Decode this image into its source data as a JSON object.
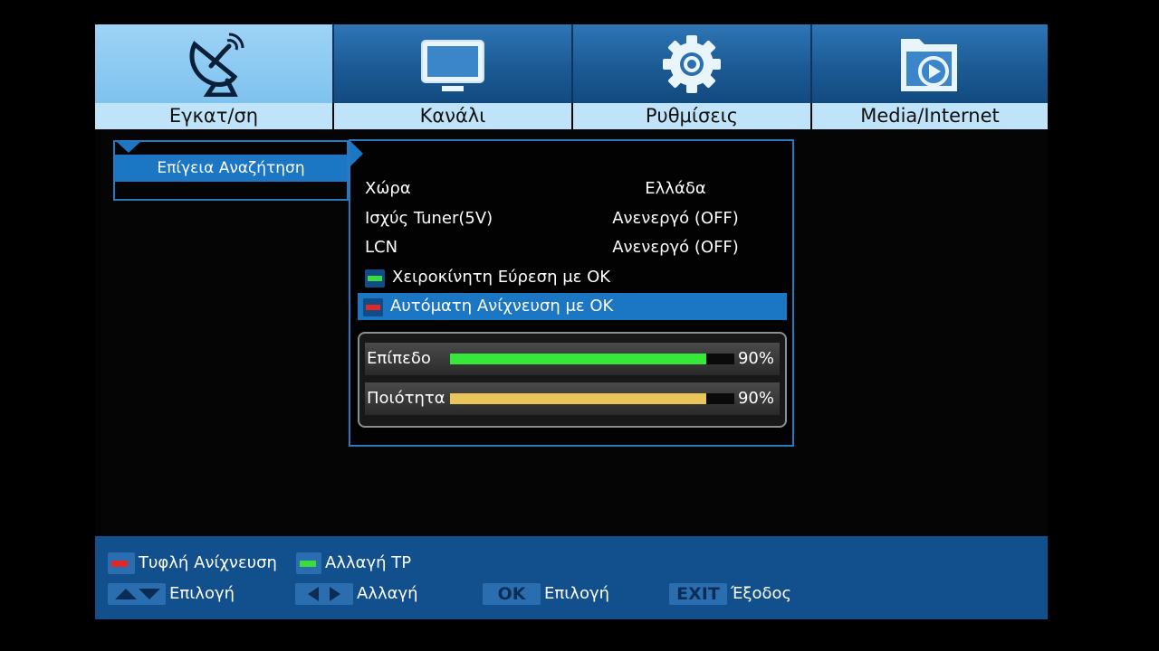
{
  "tabs": [
    {
      "label": "Εγκατ/ση",
      "icon": "satellite-dish-icon",
      "active": true
    },
    {
      "label": "Κανάλι",
      "icon": "tv-icon",
      "active": false
    },
    {
      "label": "Ρυθμίσεις",
      "icon": "gear-icon",
      "active": false
    },
    {
      "label": "Media/Internet",
      "icon": "media-folder-icon",
      "active": false
    }
  ],
  "left_menu": {
    "selected_item": "Επίγεια Αναζήτηση"
  },
  "settings": {
    "country": {
      "label": "Χώρα",
      "value": "Ελλάδα"
    },
    "tuner_power": {
      "label": "Ισχύς Tuner(5V)",
      "value": "Ανενεργό (OFF)"
    },
    "lcn": {
      "label": "LCN",
      "value": "Ανενεργό (OFF)"
    },
    "manual_search": {
      "label": "Χειροκίνητη Εύρεση με ΟΚ",
      "key_color": "#3ddc3d"
    },
    "auto_scan": {
      "label": "Αυτόματη Ανίχνευση με ΟΚ",
      "key_color": "#e02828"
    }
  },
  "signal": {
    "level": {
      "label": "Επίπεδο",
      "value_text": "90%",
      "fraction": 0.9,
      "color": "#35e83a"
    },
    "quality": {
      "label": "Ποιότητα",
      "value_text": "90%",
      "fraction": 0.9,
      "color": "#e9c65a"
    }
  },
  "help_bar": {
    "blind_scan": {
      "text": "Τυφλή Ανίχνευση",
      "key_color": "#e02828"
    },
    "change_tp": {
      "text": "Αλλαγή TP",
      "key_color": "#3ddc3d"
    },
    "updown": {
      "text": "Επιλογή",
      "icon": "up-down-arrows-icon"
    },
    "leftright": {
      "text": "Αλλαγή",
      "icon": "left-right-arrows-icon"
    },
    "ok": {
      "key": "OK",
      "text": "Επιλογή"
    },
    "exit": {
      "key": "EXIT",
      "text": "Έξοδος"
    }
  },
  "colors": {
    "accent": "#1b76c4",
    "panel_border": "#2a78c0",
    "help_bar": "#11508d"
  }
}
